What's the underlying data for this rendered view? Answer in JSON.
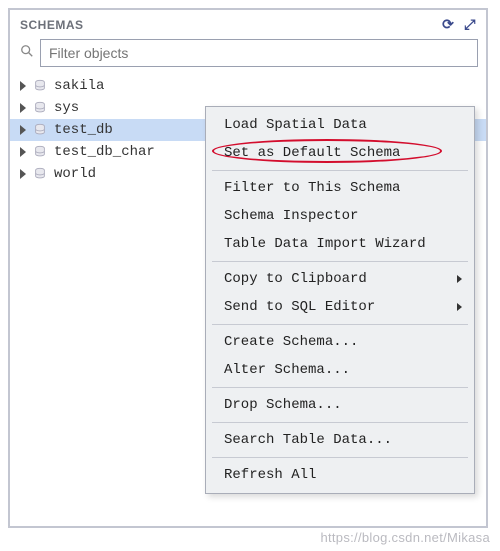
{
  "header": {
    "title": "SCHEMAS",
    "refresh_icon": "⟳",
    "expand_icon": "⤢"
  },
  "search": {
    "placeholder": "Filter objects",
    "icon": "🔍"
  },
  "tree": {
    "items": [
      {
        "label": "sakila",
        "selected": false
      },
      {
        "label": "sys",
        "selected": false
      },
      {
        "label": "test_db",
        "selected": true
      },
      {
        "label": "test_db_char",
        "selected": false
      },
      {
        "label": "world",
        "selected": false
      }
    ]
  },
  "context_menu": {
    "groups": [
      [
        {
          "label": "Load Spatial Data",
          "submenu": false
        },
        {
          "label": "Set as Default Schema",
          "submenu": false,
          "highlighted": true
        }
      ],
      [
        {
          "label": "Filter to This Schema",
          "submenu": false
        },
        {
          "label": "Schema Inspector",
          "submenu": false
        },
        {
          "label": "Table Data Import Wizard",
          "submenu": false
        }
      ],
      [
        {
          "label": "Copy to Clipboard",
          "submenu": true
        },
        {
          "label": "Send to SQL Editor",
          "submenu": true
        }
      ],
      [
        {
          "label": "Create Schema...",
          "submenu": false
        },
        {
          "label": "Alter Schema...",
          "submenu": false
        }
      ],
      [
        {
          "label": "Drop Schema...",
          "submenu": false
        }
      ],
      [
        {
          "label": "Search Table Data...",
          "submenu": false
        }
      ],
      [
        {
          "label": "Refresh All",
          "submenu": false
        }
      ]
    ]
  },
  "watermark": "https://blog.csdn.net/Mikasa"
}
